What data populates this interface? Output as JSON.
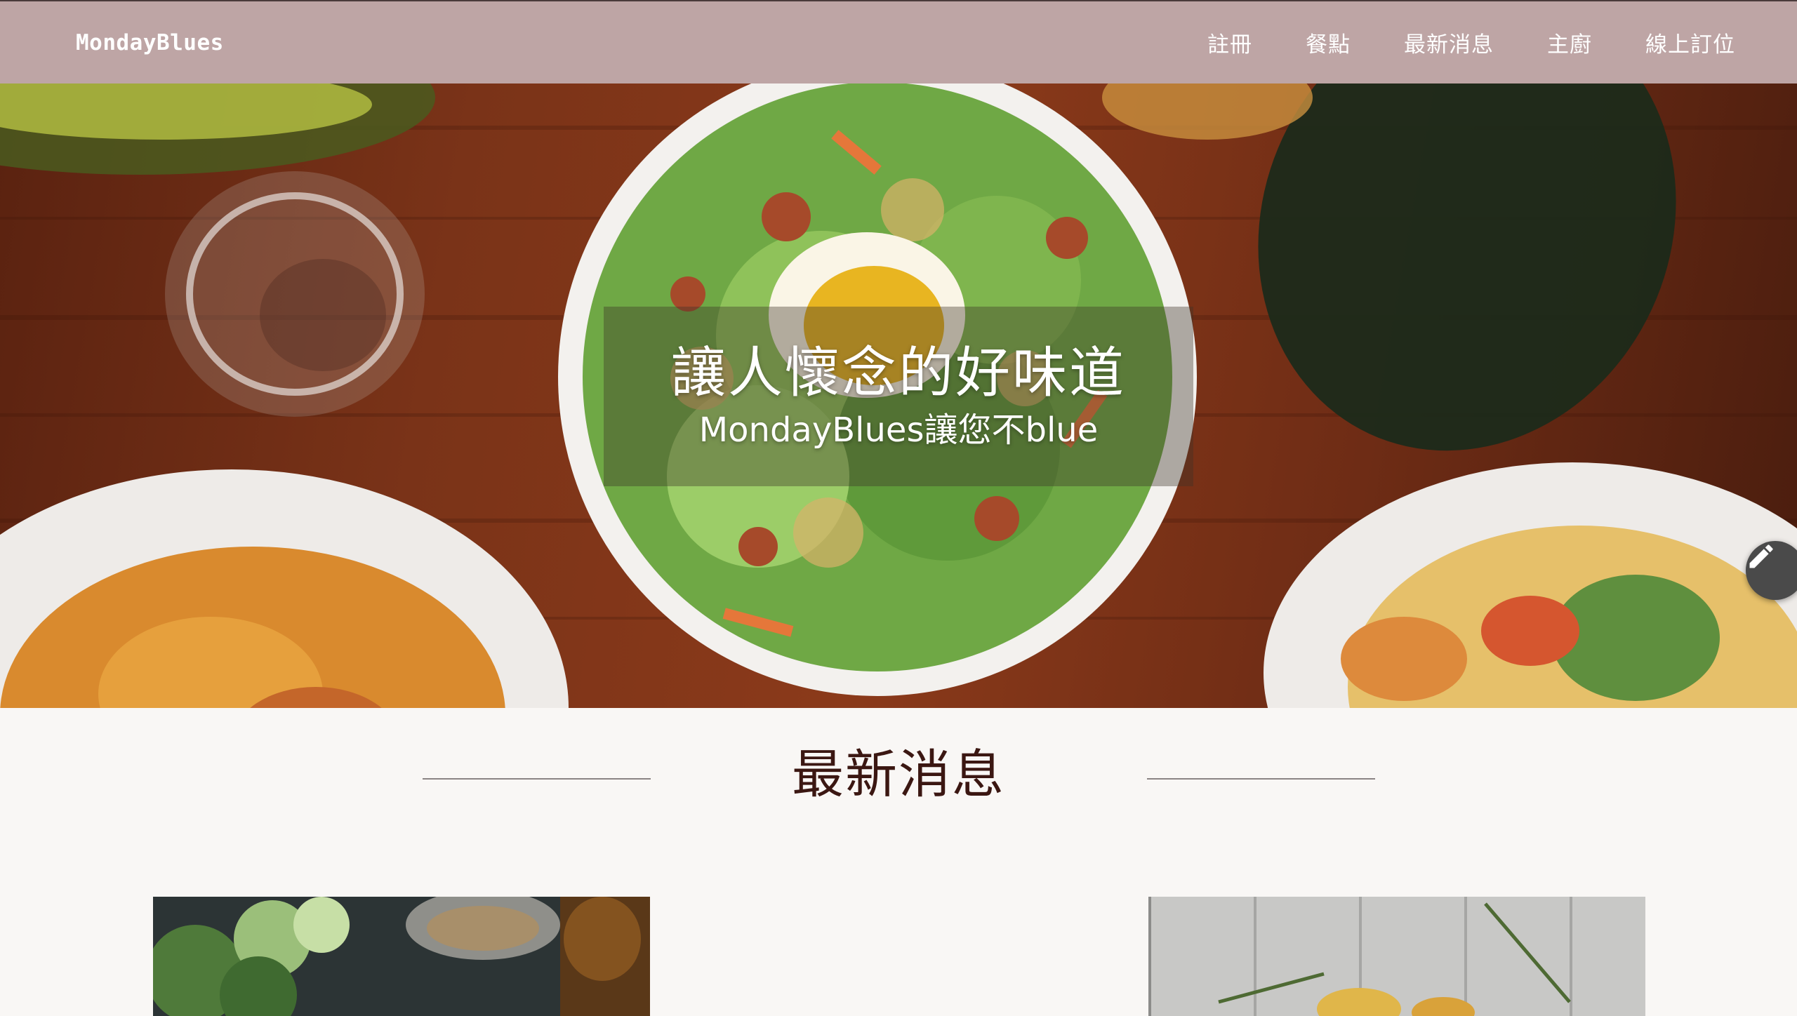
{
  "navbar": {
    "brand": "MondayBlues",
    "links": [
      {
        "label": "註冊"
      },
      {
        "label": "餐點"
      },
      {
        "label": "最新消息"
      },
      {
        "label": "主廚"
      },
      {
        "label": "線上訂位"
      }
    ]
  },
  "hero": {
    "title": "讓人懷念的好味道",
    "subtitle": "MondayBlues讓您不blue",
    "edit_icon": "pencil-icon"
  },
  "news": {
    "heading": "最新消息"
  },
  "colors": {
    "navbar_bg": "#bea5a5",
    "page_bg": "#f9f7f5",
    "heading_text": "#3b1712"
  }
}
